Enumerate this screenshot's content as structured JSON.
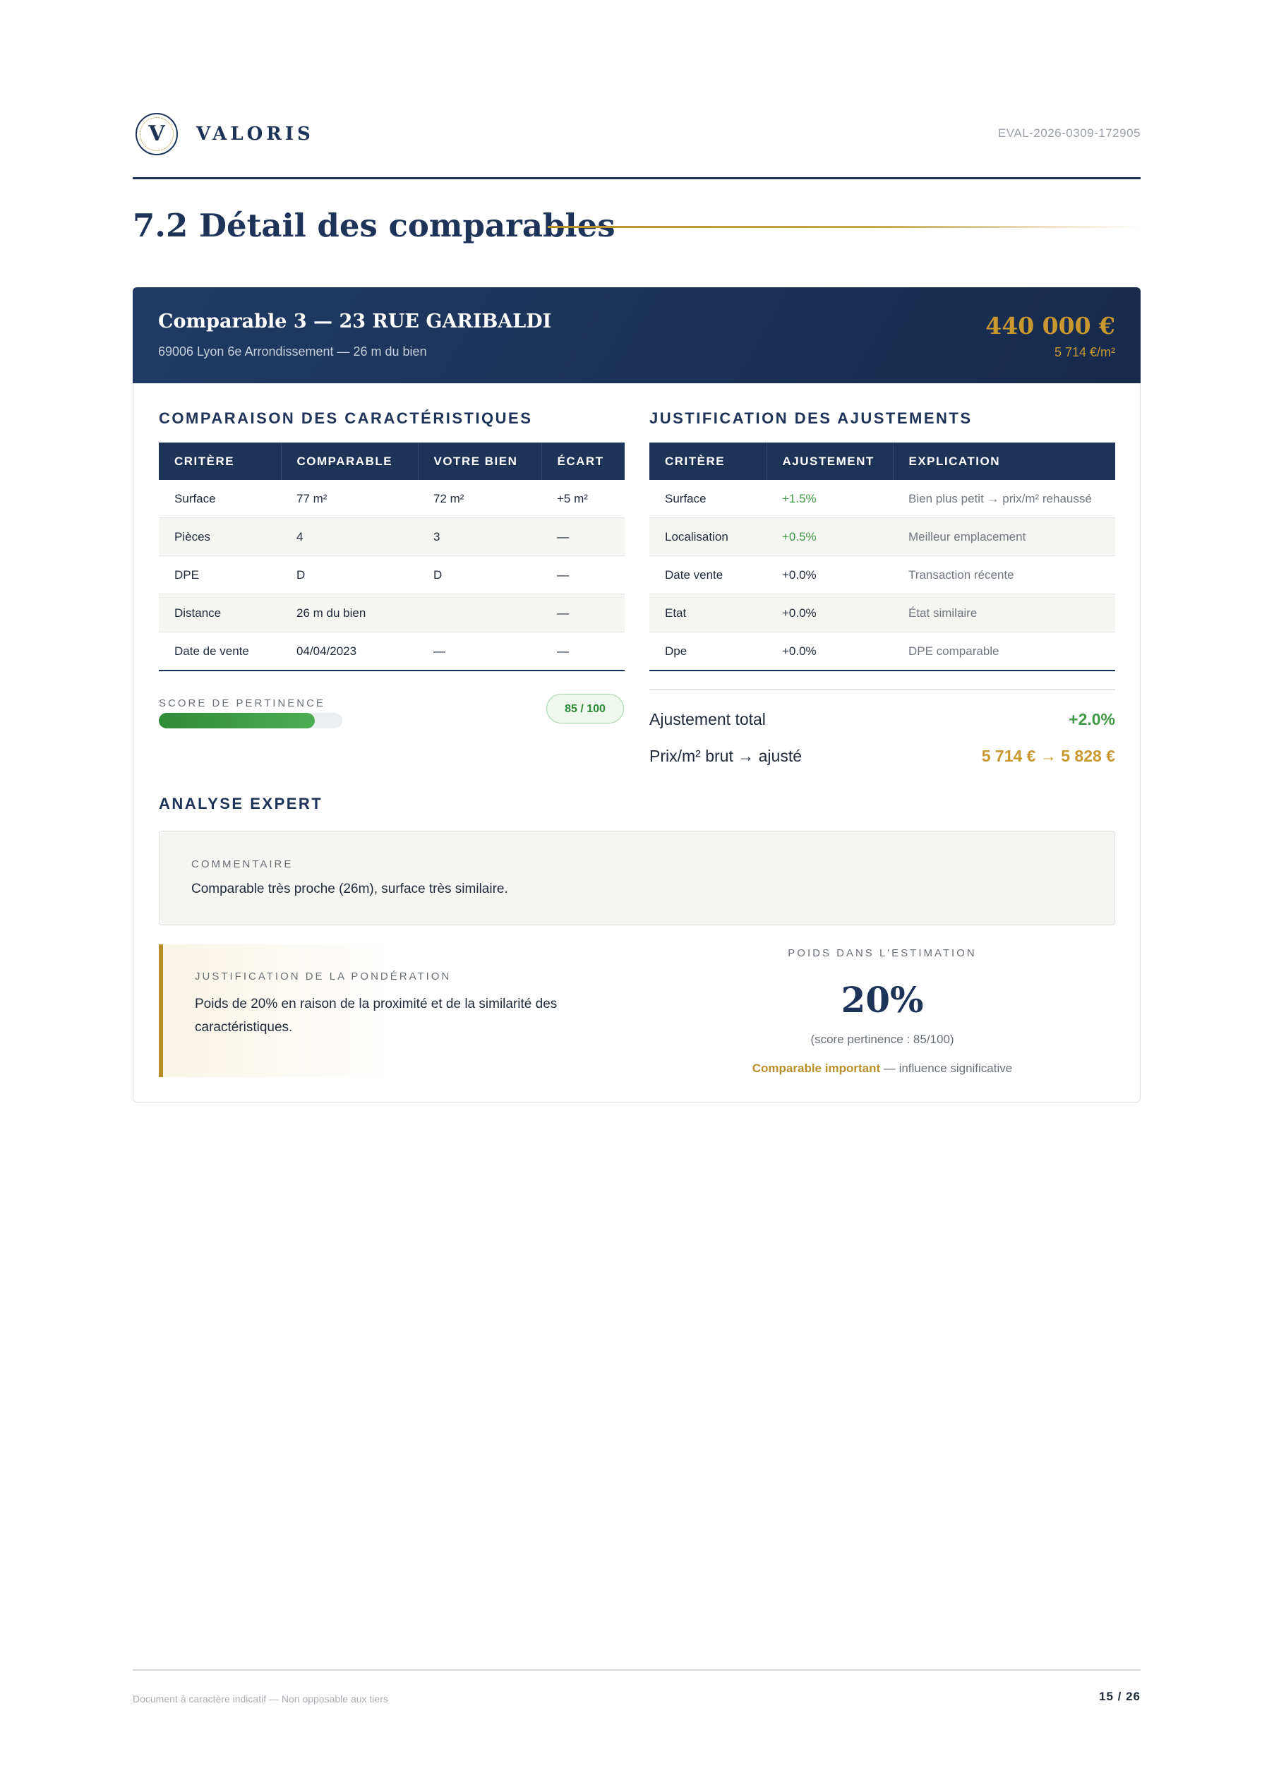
{
  "header": {
    "logo_letter": "V",
    "brand": "VALORIS",
    "reference": "EVAL-2026-0309-172905"
  },
  "section": {
    "title": "7.2 Détail des comparables"
  },
  "comparable": {
    "title": "Comparable 3 — 23 RUE GARIBALDI",
    "subtitle": "69006 Lyon 6e Arrondissement — 26 m du bien",
    "price": "440 000 €",
    "price_per_m2": "5 714 €/m²"
  },
  "characteristics": {
    "heading": "COMPARAISON DES CARACTÉRISTIQUES",
    "columns": [
      "CRITÈRE",
      "COMPARABLE",
      "VOTRE BIEN",
      "ÉCART"
    ],
    "rows": [
      [
        "Surface",
        "77 m²",
        "72 m²",
        "+5 m²"
      ],
      [
        "Pièces",
        "4",
        "3",
        "—"
      ],
      [
        "DPE",
        "D",
        "D",
        "—"
      ],
      [
        "Distance",
        "26 m du bien",
        "",
        "—"
      ],
      [
        "Date de vente",
        "04/04/2023",
        "—",
        "—"
      ]
    ]
  },
  "score": {
    "label": "SCORE DE PERTINENCE",
    "badge": "85 / 100",
    "fraction": 0.85
  },
  "adjustments": {
    "heading": "JUSTIFICATION DES AJUSTEMENTS",
    "columns": [
      "CRITÈRE",
      "AJUSTEMENT",
      "EXPLICATION"
    ],
    "rows": [
      [
        "Surface",
        "+1.5%",
        "Bien plus petit → prix/m² rehaussé"
      ],
      [
        "Localisation",
        "+0.5%",
        "Meilleur emplacement"
      ],
      [
        "Date vente",
        "+0.0%",
        "Transaction récente"
      ],
      [
        "Etat",
        "+0.0%",
        "État similaire"
      ],
      [
        "Dpe",
        "+0.0%",
        "DPE comparable"
      ]
    ],
    "total_label": "Ajustement total",
    "total_value": "+2.0%",
    "ppm_label": "Prix/m² brut → ajusté",
    "ppm_value": "5 714 € → 5 828 €"
  },
  "analysis": {
    "heading": "ANALYSE EXPERT",
    "comment_label": "COMMENTAIRE",
    "comment_text": "Comparable très proche (26m), surface très similaire.",
    "justif_label": "JUSTIFICATION DE LA PONDÉRATION",
    "justif_text": "Poids de 20% en raison de la proximité et de la similarité des caractéristiques.",
    "weight_label": "POIDS DANS L'ESTIMATION",
    "weight_value": "20%",
    "weight_score": "(score pertinence : 85/100)",
    "weight_note_strong": "Comparable important",
    "weight_note_rest": " — influence significative"
  },
  "footer": {
    "disclaimer": "Document à caractère indicatif — Non opposable aux tiers",
    "page": "15 / 26"
  },
  "colors": {
    "navy": "#1e3358",
    "gold": "#b98f2a",
    "green": "#3f9a45"
  }
}
